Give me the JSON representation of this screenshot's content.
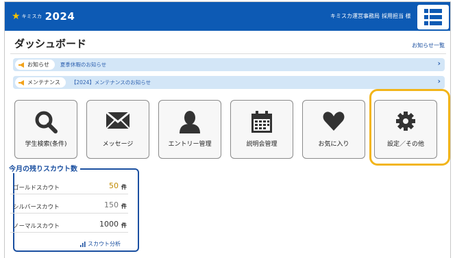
{
  "header": {
    "logo_small": "キミスカ",
    "logo_year": "2024",
    "org": "キミスカ運営事務局",
    "user": "採用担当 様"
  },
  "title": {
    "text": "ダッシュボード",
    "news_all": "お知らせ一覧"
  },
  "notices": [
    {
      "tag": "お知らせ",
      "text": "夏季休暇のお知らせ"
    },
    {
      "tag": "メンテナンス",
      "text": "【2024】メンテナンスのお知らせ"
    }
  ],
  "tiles": [
    {
      "label": "学生検索(条件)",
      "icon": "search-icon"
    },
    {
      "label": "メッセージ",
      "icon": "mail-icon"
    },
    {
      "label": "エントリー管理",
      "icon": "person-icon"
    },
    {
      "label": "説明会管理",
      "icon": "calendar-icon"
    },
    {
      "label": "お気に入り",
      "icon": "heart-icon"
    },
    {
      "label": "設定／その他",
      "icon": "gear-icon"
    }
  ],
  "scout": {
    "title": "今月の残りスカウト数",
    "rows": [
      {
        "name": "ゴールドスカウト",
        "count": "50",
        "unit": "件"
      },
      {
        "name": "シルバースカウト",
        "count": "150",
        "unit": "件"
      },
      {
        "name": "ノーマルスカウト",
        "count": "1000",
        "unit": "件"
      }
    ],
    "analysis": "スカウト分析"
  },
  "colors": {
    "header_bg": "#0d5ab4",
    "highlight": "#f2b51a",
    "notice_bg": "#d3e6f7",
    "gold": "#c08a00"
  }
}
